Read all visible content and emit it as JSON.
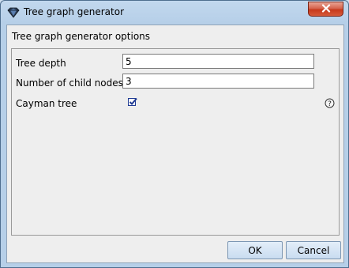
{
  "window": {
    "title": "Tree graph generator",
    "app_icon": "diamond-app-icon",
    "close_icon": "close-icon"
  },
  "dialog": {
    "section_title": "Tree graph generator options",
    "fields": [
      {
        "label": "Tree depth",
        "value": "5"
      },
      {
        "label": "Number of child nodes",
        "value": "3"
      }
    ],
    "cayman": {
      "label": "Cayman tree",
      "checked": true,
      "help_icon": "help-icon"
    }
  },
  "buttons": {
    "ok": "OK",
    "cancel": "Cancel"
  },
  "colors": {
    "title_gradient_top": "#c2d8ee",
    "client_background": "#eeeeee",
    "close_button": "#c7391c",
    "checkbox_mark": "#1f3a93"
  }
}
